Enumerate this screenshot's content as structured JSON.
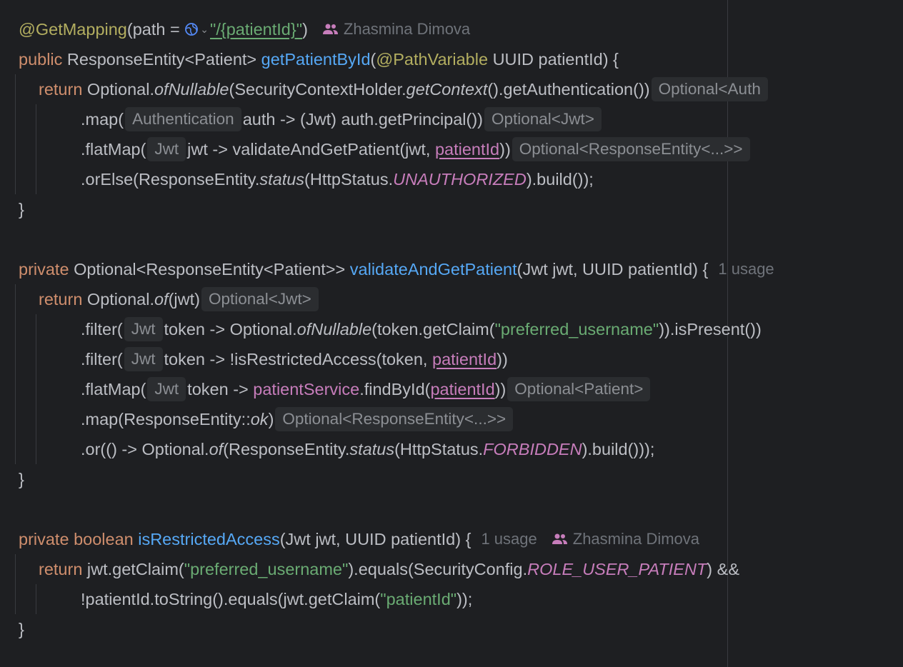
{
  "colors": {
    "background": "#1e1f22",
    "keyword": "#cf8e6d",
    "annotation": "#b3ae60",
    "method": "#56a8f5",
    "string": "#6aab73",
    "field": "#c77dbb",
    "text": "#bcbec4",
    "hint_bg": "#2b2d30"
  },
  "icons": {
    "people": "people-icon",
    "globe": "globe-icon",
    "chevron": "chevron-down-icon"
  },
  "code": {
    "l1": {
      "annotation": "@GetMapping",
      "open": "(path = ",
      "path": "\"/{patientId}\"",
      "close": ")",
      "author": "Zhasmina Dimova"
    },
    "l2": {
      "kw": "public",
      "type": " ResponseEntity<Patient> ",
      "fn": "getPatientById",
      "p1": "(",
      "ann": "@PathVariable",
      "p2": " UUID patientId) {"
    },
    "l3": {
      "kw": "return",
      "a": " Optional.",
      "b": "ofNullable",
      "c": "(SecurityContextHolder.",
      "d": "getContext",
      "e": "().getAuthentication())",
      "hint": "Optional<Auth"
    },
    "l4": {
      "a": ".map(",
      "hint1": "Authentication",
      "b": "auth -> (Jwt) auth.getPrincipal())",
      "hint2": "Optional<Jwt>"
    },
    "l5": {
      "a": ".flatMap(",
      "hint1": "Jwt",
      "b": "jwt -> validateAndGetPatient(jwt, ",
      "c": "patientId",
      "d": "))",
      "hint2": "Optional<ResponseEntity<...>>"
    },
    "l6": {
      "a": ".orElse(ResponseEntity.",
      "b": "status",
      "c": "(HttpStatus.",
      "d": "UNAUTHORIZED",
      "e": ").build());"
    },
    "l7": {
      "a": "}"
    },
    "l8": {
      "kw": "private",
      "type": " Optional<ResponseEntity<Patient>> ",
      "fn": "validateAndGetPatient",
      "b": "(Jwt jwt, UUID patientId) {",
      "usage": "1 usage"
    },
    "l9": {
      "kw": "return",
      "a": " Optional.",
      "b": "of",
      "c": "(jwt)",
      "hint": "Optional<Jwt>"
    },
    "l10": {
      "a": ".filter(",
      "hint1": "Jwt",
      "b": "token -> Optional.",
      "c": "ofNullable",
      "d": "(token.getClaim(",
      "e": "\"preferred_username\"",
      "f": ")).isPresent())"
    },
    "l11": {
      "a": ".filter(",
      "hint1": "Jwt",
      "b": "token -> !isRestrictedAccess(token, ",
      "c": "patientId",
      "d": "))"
    },
    "l12": {
      "a": ".flatMap(",
      "hint1": "Jwt",
      "b": "token -> ",
      "c": "patientService",
      "d": ".findById(",
      "e": "patientId",
      "f": "))",
      "hint2": "Optional<Patient>"
    },
    "l13": {
      "a": ".map(ResponseEntity::",
      "b": "ok",
      "c": ")",
      "hint": "Optional<ResponseEntity<...>>"
    },
    "l14": {
      "a": ".or(() -> Optional.",
      "b": "of",
      "c": "(ResponseEntity.",
      "d": "status",
      "e": "(HttpStatus.",
      "f": "FORBIDDEN",
      "g": ").build()));"
    },
    "l15": {
      "a": "}"
    },
    "l16": {
      "kw": "private boolean",
      "sp": " ",
      "fn": "isRestrictedAccess",
      "b": "(Jwt jwt, UUID patientId) {",
      "usage": "1 usage",
      "author": "Zhasmina Dimova"
    },
    "l17": {
      "kw": "return",
      "a": " jwt.getClaim(",
      "b": "\"preferred_username\"",
      "c": ").equals(SecurityConfig.",
      "d": "ROLE_USER_PATIENT",
      "e": ") &&"
    },
    "l18": {
      "a": "!patientId.toString().equals(jwt.getClaim(",
      "b": "\"patientId\"",
      "c": "));"
    },
    "l19": {
      "a": "}"
    }
  }
}
